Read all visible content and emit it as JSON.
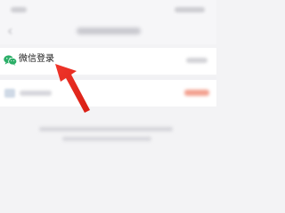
{
  "login_row": {
    "label": "微信登录",
    "icon": "wechat-icon",
    "icon_color": "#2aae67"
  },
  "annotation": {
    "arrow_color": "#e8281e"
  }
}
